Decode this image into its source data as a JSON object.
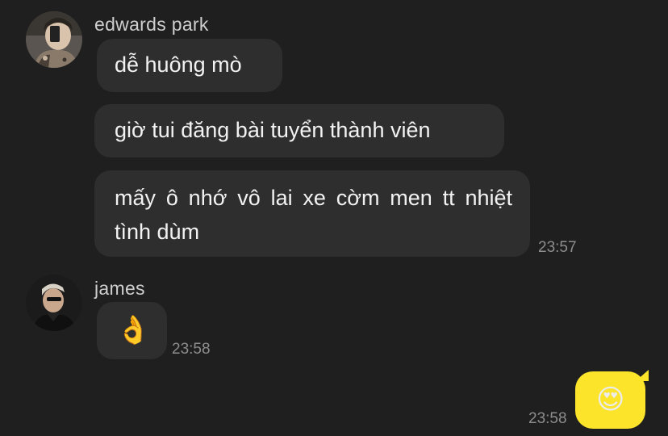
{
  "conversation": {
    "groups": [
      {
        "sender": "edwards park",
        "avatar_icon": "person-photo-avatar",
        "messages": [
          "dễ huông mò",
          "giờ tui đăng bài tuyển thành viên",
          "mấy ô nhớ vô lai xe cờm men tt nhiệt tình dùm"
        ],
        "time": "23:57"
      },
      {
        "sender": "james",
        "avatar_icon": "person-photo-avatar",
        "messages": [
          "👌"
        ],
        "time": "23:58"
      }
    ],
    "outgoing": {
      "message": "😍",
      "time": "23:58",
      "bubble_color": "#fbe42a"
    }
  },
  "colors": {
    "background": "#1f1f1f",
    "incoming_bubble": "#2e2e2e",
    "timestamp": "#8d8d8d",
    "sender_name": "#cfcfcf"
  }
}
